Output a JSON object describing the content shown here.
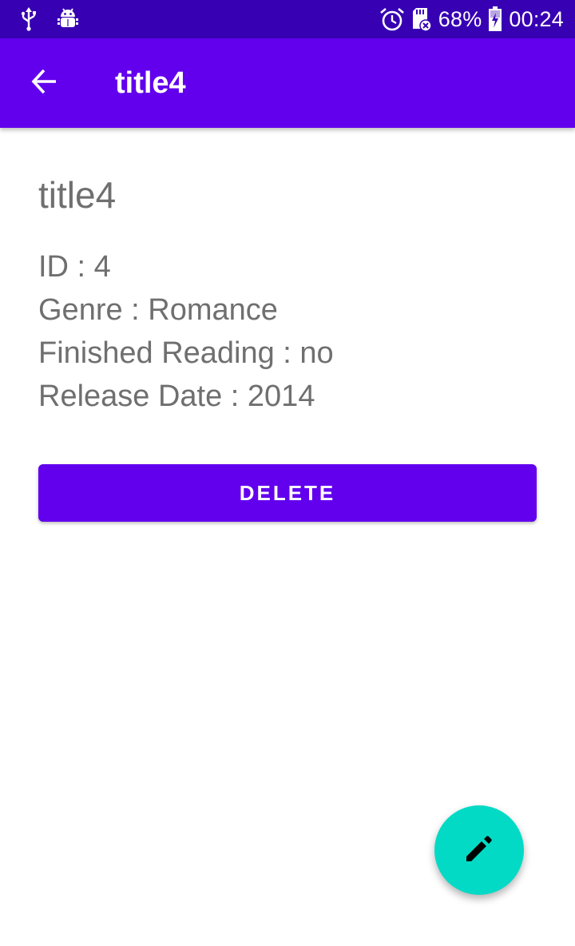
{
  "status_bar": {
    "icons_left": [
      "usb-icon",
      "android-debug-icon"
    ],
    "icons_right": [
      "alarm-icon",
      "sd-card-icon",
      "battery-charging-icon"
    ],
    "battery_percent": "68%",
    "time": "00:24"
  },
  "app_bar": {
    "back_icon": "arrow-back-icon",
    "title": "title4"
  },
  "book": {
    "title": "title4",
    "id_line": "ID : 4",
    "genre_line": "Genre : Romance",
    "finished_line": "Finished Reading : no",
    "release_line": "Release Date : 2014"
  },
  "actions": {
    "delete_label": "DELETE",
    "edit_fab_icon": "edit-pencil-icon"
  },
  "colors": {
    "status_bar": "#3700b3",
    "primary": "#6200ee",
    "fab": "#03dac5",
    "body_text": "#6f6f6f"
  }
}
